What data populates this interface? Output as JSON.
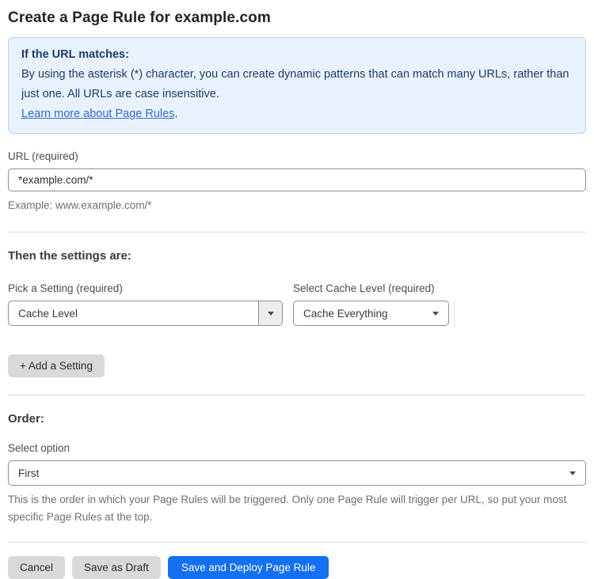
{
  "page": {
    "title": "Create a Page Rule for example.com"
  },
  "info_box": {
    "heading": "If the URL matches:",
    "body": "By using the asterisk (*) character, you can create dynamic patterns that can match many URLs, rather than just one. All URLs are case insensitive.",
    "link_label": "Learn more about Page Rules",
    "link_suffix": "."
  },
  "url_field": {
    "label": "URL (required)",
    "value": "*example.com/*",
    "helper": "Example: www.example.com/*"
  },
  "settings_section": {
    "heading": "Then the settings are:",
    "setting_picker": {
      "label": "Pick a Setting (required)",
      "value": "Cache Level"
    },
    "cache_level_picker": {
      "label": "Select Cache Level (required)",
      "value": "Cache Everything"
    },
    "add_setting_label": "+ Add a Setting"
  },
  "order_section": {
    "heading": "Order:",
    "select_label": "Select option",
    "select_value": "First",
    "helper": "This is the order in which your Page Rules will be triggered. Only one Page Rule will trigger per URL, so put your most specific Page Rules at the top."
  },
  "footer": {
    "cancel_label": "Cancel",
    "save_draft_label": "Save as Draft",
    "save_deploy_label": "Save and Deploy Page Rule"
  },
  "icons": {
    "dropdown_arrow": "caret-down"
  },
  "colors": {
    "accent_blue": "#1570f1",
    "info_background": "#e9f2fc",
    "info_border": "#b9d3f0",
    "info_text": "#1d3c6e",
    "link_blue": "#2e6bd0",
    "button_gray": "#d9d9d9"
  }
}
